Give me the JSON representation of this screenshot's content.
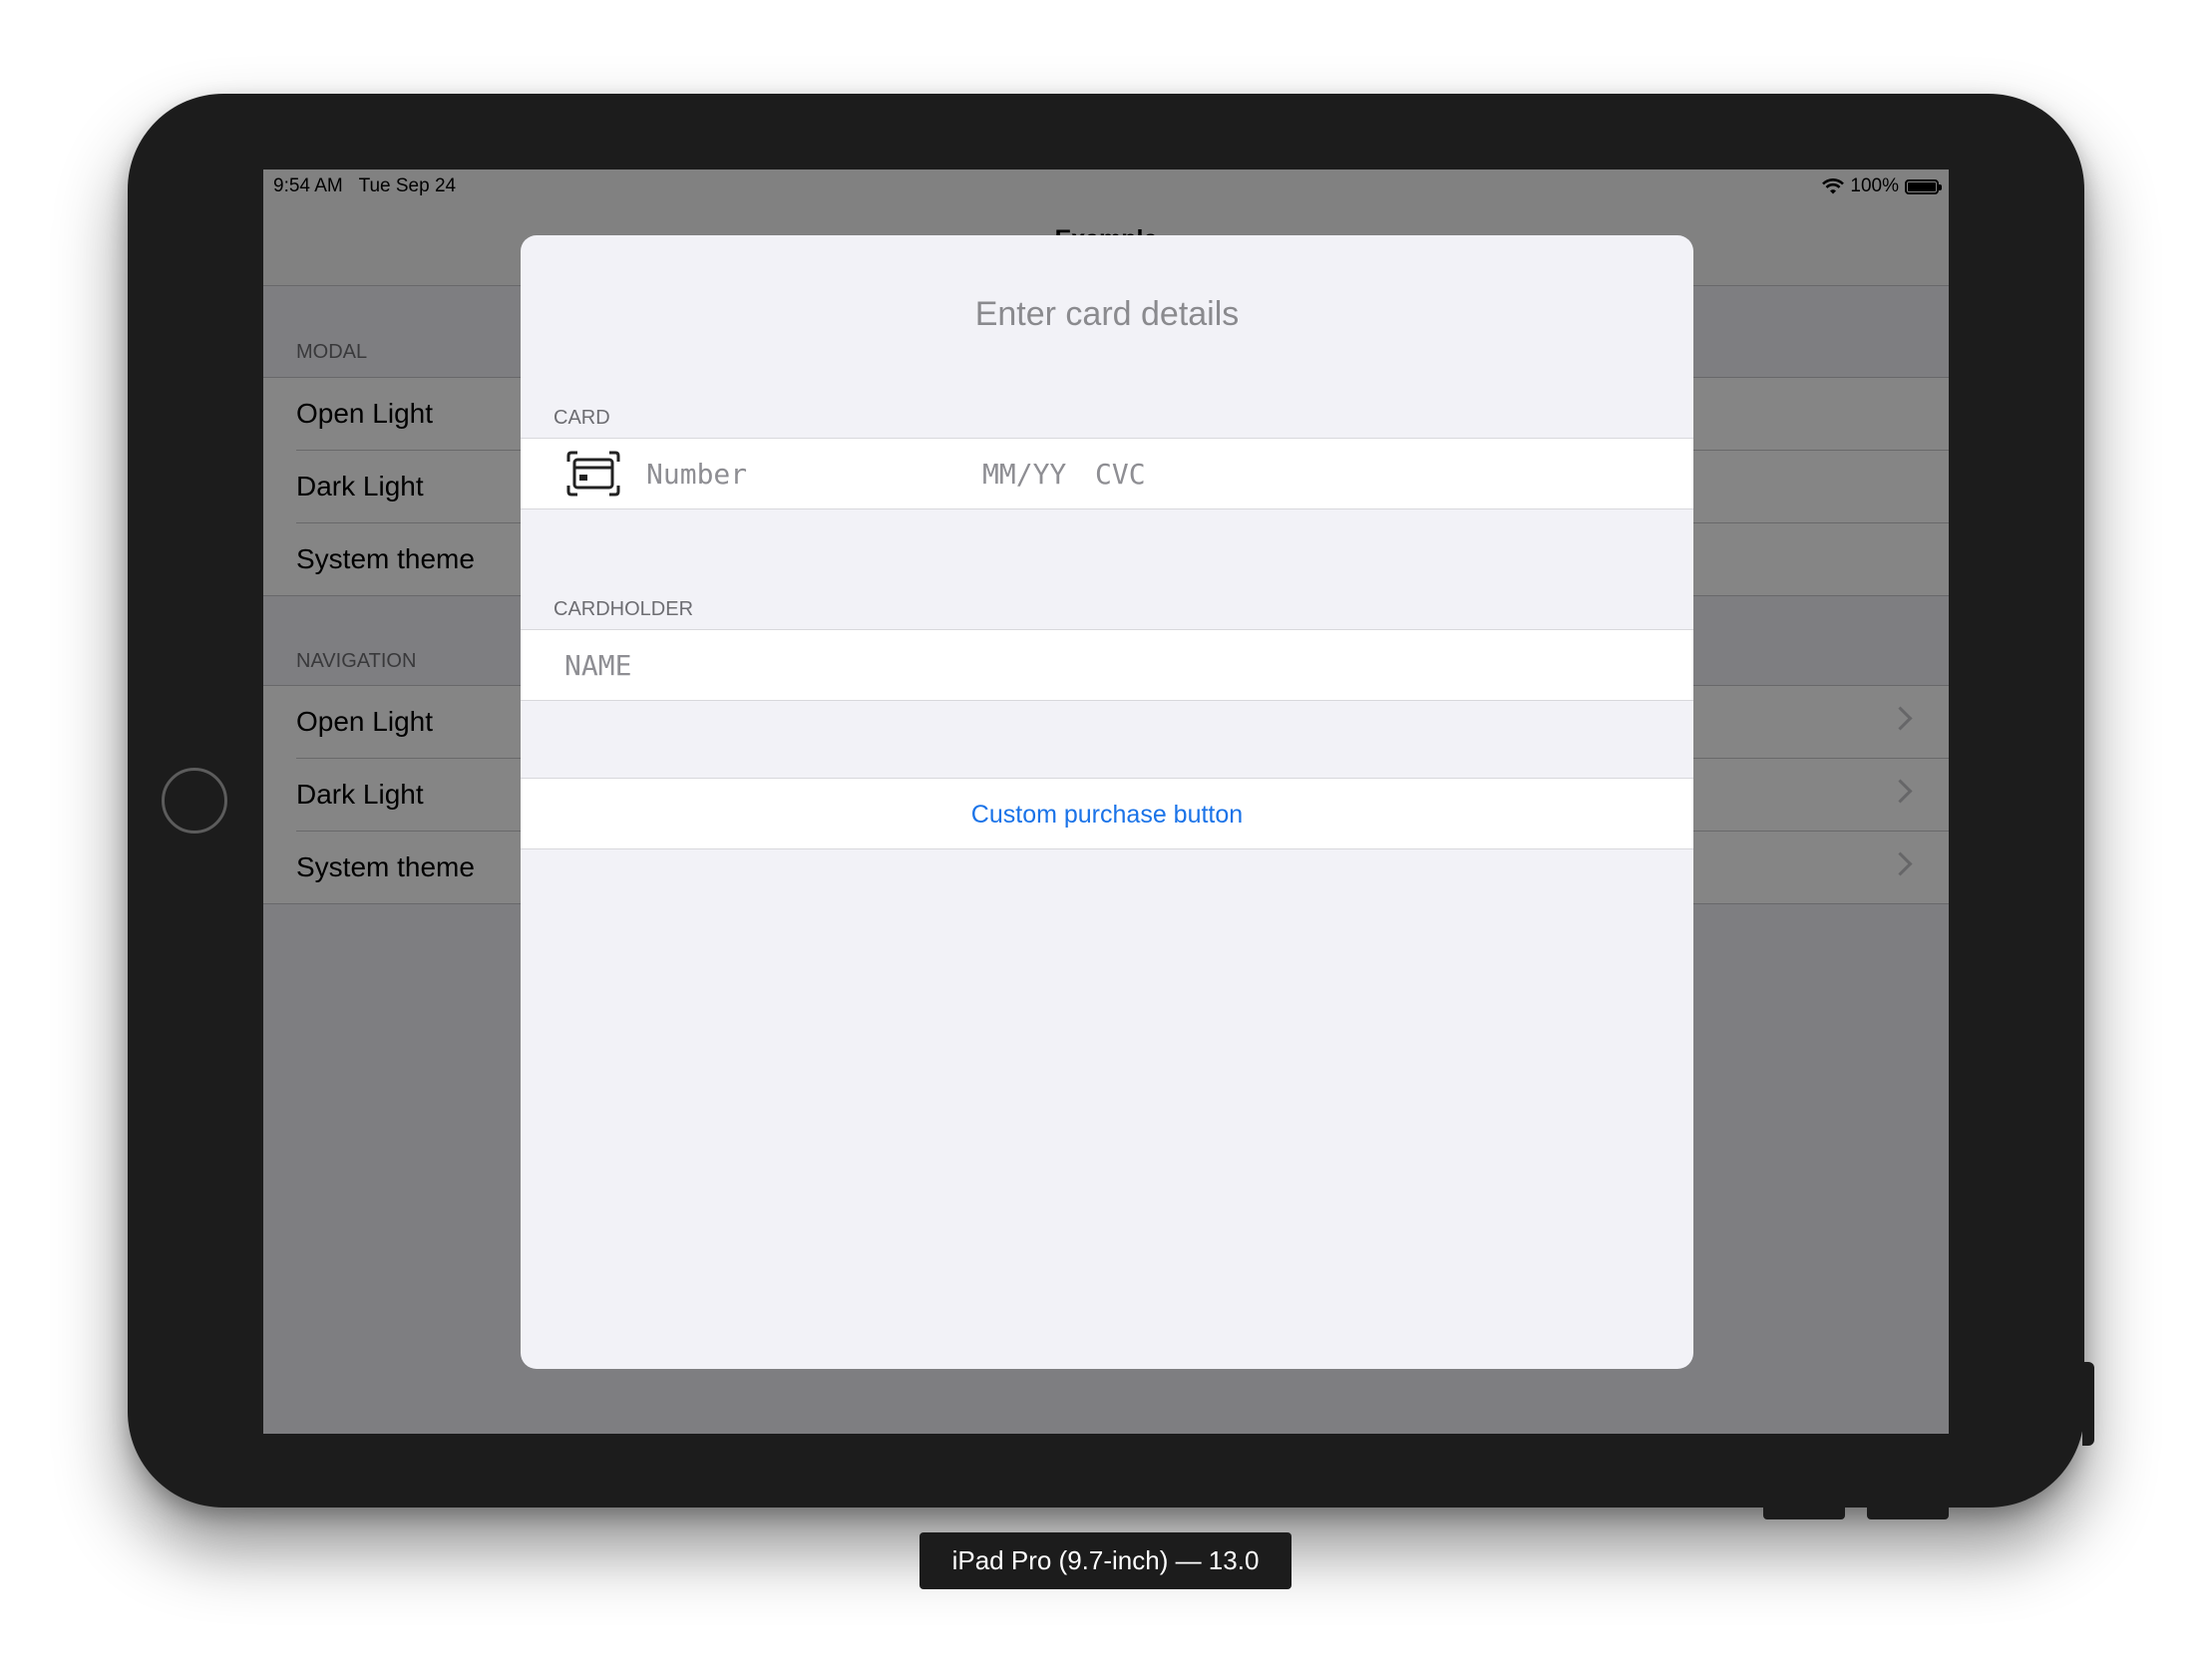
{
  "status_bar": {
    "time": "9:54 AM",
    "date": "Tue Sep 24",
    "battery": "100%"
  },
  "background_list": {
    "sections": [
      {
        "header": "MODAL",
        "items": [
          "Open Light",
          "Dark Light",
          "System theme"
        ]
      },
      {
        "header": "NAVIGATION",
        "items": [
          "Open Light",
          "Dark Light",
          "System theme"
        ]
      }
    ]
  },
  "modal": {
    "title": "Enter card details",
    "card_section_header": "CARD",
    "card_number_placeholder": "Number",
    "card_expiry_placeholder": "MM/YY",
    "card_cvc_placeholder": "CVC",
    "cardholder_section_header": "CARDHOLDER",
    "cardholder_name_placeholder": "NAME",
    "purchase_button_label": "Custom purchase button"
  },
  "device_caption": "iPad Pro (9.7-inch) — 13.0",
  "colors": {
    "accent": "#1a73e8",
    "device": "#1c1c1c"
  }
}
